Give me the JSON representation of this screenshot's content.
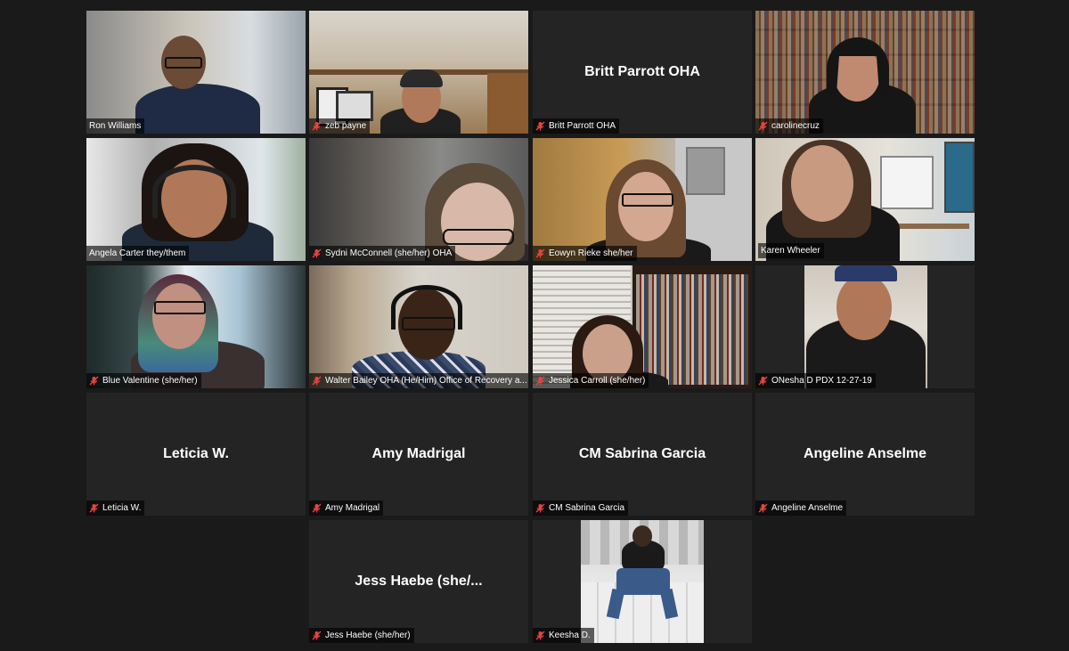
{
  "meeting": {
    "participants": [
      {
        "name": "Ron Williams",
        "display": "",
        "muted": false
      },
      {
        "name": "zeb payne",
        "display": "",
        "muted": true
      },
      {
        "name": "Britt Parrott OHA",
        "display": "Britt Parrott OHA",
        "muted": true
      },
      {
        "name": "carolinecruz",
        "display": "",
        "muted": true
      },
      {
        "name": "Angela Carter they/them",
        "display": "",
        "muted": false
      },
      {
        "name": "Sydni McConnell (she/her) OHA",
        "display": "",
        "muted": true
      },
      {
        "name": "Eowyn Rieke she/her",
        "display": "",
        "muted": true
      },
      {
        "name": "Karen Wheeler",
        "display": "",
        "muted": false,
        "active_speaker": true
      },
      {
        "name": "Blue Valentine (she/her)",
        "display": "",
        "muted": true
      },
      {
        "name": "Walter Bailey OHA (He/Him) Office of Recovery a...",
        "display": "",
        "muted": true
      },
      {
        "name": "Jessica Carroll (she/her)",
        "display": "",
        "muted": true
      },
      {
        "name": "ONesha D PDX 12-27-19",
        "display": "",
        "muted": true
      },
      {
        "name": "Leticia W.",
        "display": "Leticia W.",
        "muted": true
      },
      {
        "name": "Amy Madrigal",
        "display": "Amy Madrigal",
        "muted": true
      },
      {
        "name": "CM Sabrina Garcia",
        "display": "CM Sabrina Garcia",
        "muted": true
      },
      {
        "name": "Angeline Anselme",
        "display": "Angeline Anselme",
        "muted": true
      },
      {
        "name": "Jess Haebe (she/her)",
        "display": "Jess Haebe (she/...",
        "muted": true
      },
      {
        "name": "Keesha D.",
        "display": "",
        "muted": true
      }
    ],
    "icons": {
      "muted": "muted-microphone-icon"
    },
    "colors": {
      "active_speaker_border": "#c6e23a",
      "mute_icon": "#e5453c",
      "tile_background": "#242424",
      "page_background": "#1a1a1a"
    }
  }
}
